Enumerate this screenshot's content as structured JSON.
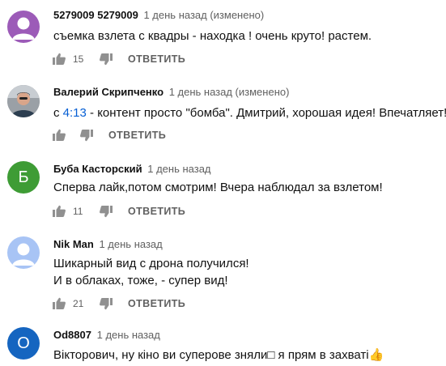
{
  "comments": [
    {
      "author": "5279009 5279009",
      "time": "1 день назад (изменено)",
      "text": "съемка взлета с квадры - находка ! очень круто! растем.",
      "likes": "15",
      "reply_label": "ОТВЕТИТЬ",
      "avatar_color": "#9c5bb8",
      "avatar_type": "person-icon"
    },
    {
      "author": "Валерий Скрипченко",
      "time": "1 день назад (изменено)",
      "text_prefix": "с ",
      "timestamp_link": "4:13",
      "text_suffix": " - контент просто \"бомба\". Дмитрий, хорошая идея! Впечатляет!",
      "likes": "",
      "reply_label": "ОТВЕТИТЬ",
      "avatar_type": "photo"
    },
    {
      "author": "Буба Касторский",
      "time": "1 день назад",
      "text": "Сперва лайк,потом смотрим! Вчера наблюдал за взлетом!",
      "likes": "11",
      "reply_label": "ОТВЕТИТЬ",
      "avatar_color": "#3e9c35",
      "avatar_letter": "Б"
    },
    {
      "author": "Nik Man",
      "time": "1 день назад",
      "text_line1": "Шикарный вид с дрона получился!",
      "text_line2": "И в облаках, тоже, - супер вид!",
      "likes": "21",
      "reply_label": "ОТВЕТИТЬ",
      "avatar_color": "#a8c4f5",
      "avatar_type": "person-icon"
    },
    {
      "author": "Od8807",
      "time": "1 день назад",
      "text": "Вікторович, ну кіно ви суперове зняли□ я прям в захваті👍",
      "avatar_color": "#1565c0",
      "avatar_letter": "O"
    }
  ]
}
